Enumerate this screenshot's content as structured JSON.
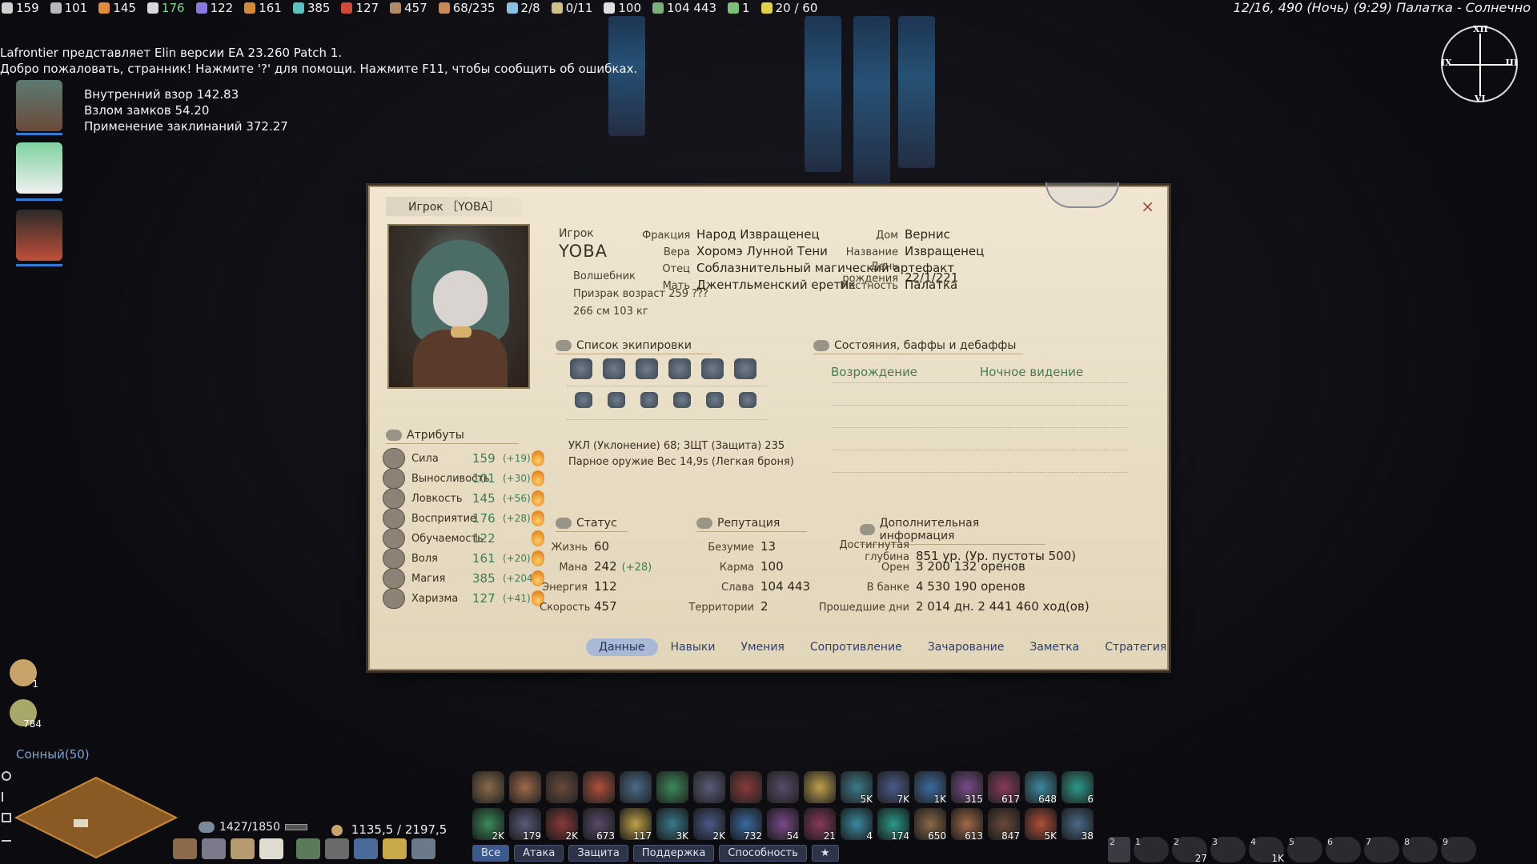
{
  "topbar": {
    "stats": [
      {
        "icon": "sword-icon",
        "value": "159",
        "color": "#cfcfcf"
      },
      {
        "icon": "muscle-icon",
        "value": "101",
        "color": "#b8b8b8"
      },
      {
        "icon": "foot-icon",
        "value": "145",
        "color": "#e38b3c"
      },
      {
        "icon": "eye-icon",
        "value": "176",
        "color": "#d9d9d9",
        "highlight": true
      },
      {
        "icon": "book-icon",
        "value": "122",
        "color": "#8a7ae0"
      },
      {
        "icon": "shield-icon",
        "value": "161",
        "color": "#d08a3a"
      },
      {
        "icon": "magic-icon",
        "value": "385",
        "color": "#5fc0c0"
      },
      {
        "icon": "charm-icon",
        "value": "127",
        "color": "#d04a3a"
      },
      {
        "icon": "bag-icon",
        "value": "457",
        "color": "#b08a6a"
      },
      {
        "icon": "hand-icon",
        "value": "68/235",
        "color": "#c98a5a"
      },
      {
        "icon": "cloud-icon",
        "value": "2/8",
        "color": "#8ac0e0"
      },
      {
        "icon": "boot-icon",
        "value": "0/11",
        "color": "#d0c08a"
      },
      {
        "icon": "star-icon",
        "value": "100",
        "color": "#e0e0e0"
      },
      {
        "icon": "badge-icon",
        "value": "104 443",
        "color": "#7ab07a"
      },
      {
        "icon": "leaf-icon",
        "value": "1",
        "color": "#7ac07a"
      },
      {
        "icon": "lightning-icon",
        "value": "20 / 60",
        "color": "#e0d04a"
      }
    ],
    "right_text": "12/16, 490 (Ночь)  (9:29)  Палатка - Солнечно"
  },
  "compass": {
    "n": "XII",
    "e": "III",
    "s": "VI",
    "w": "IX"
  },
  "log": [
    "Lafrontier представляет Elin версии EA 23.260 Patch 1.",
    "Добро пожаловать, странник! Нажмите '?' для помощи. Нажмите F11, чтобы сообщить об ошибках."
  ],
  "skills_progress": [
    "Внутренний взор  142.83",
    "Взлом замков  54.20",
    "Применение заклинаний  372.27"
  ],
  "panel": {
    "title": "Игрок ［YOBA］",
    "close": "×",
    "player_caption": "Игрок",
    "name": "YOBA",
    "class": "Волшебник",
    "race_age": "Призрак возраст 259 ???",
    "size": "266 см 103 кг",
    "profile": [
      {
        "k": "Фракция",
        "v": "Народ Извращенец"
      },
      {
        "k": "Вера",
        "v": "Хоромэ Лунной Тени"
      },
      {
        "k": "Отец",
        "v": "Соблазнительный магический артефакт"
      },
      {
        "k": "Мать",
        "v": "Джентльменский еретик"
      }
    ],
    "profile2": [
      {
        "k": "Дом",
        "v": "Вернис"
      },
      {
        "k": "Название",
        "v": "Извращенец"
      },
      {
        "k": "День рождения",
        "v": "22/1/221"
      },
      {
        "k": "Местность",
        "v": "Палатка"
      }
    ],
    "equip_title": "Список экипировки",
    "equip_summary_1": "УКЛ (Уклонение) 68; ЗЩТ (Защита) 235",
    "equip_summary_2": "Парное оружие Вес 14,9s (Легкая броня)",
    "buffs_title": "Состояния, баффы и дебаффы",
    "buffs": [
      "Возрождение",
      "Ночное видение"
    ],
    "attr_title": "Атрибуты",
    "attributes": [
      {
        "name": "Сила",
        "value": "159",
        "bonus": "(+19)"
      },
      {
        "name": "Выносливость",
        "value": "101",
        "bonus": "(+30)"
      },
      {
        "name": "Ловкость",
        "value": "145",
        "bonus": "(+56)"
      },
      {
        "name": "Восприятие",
        "value": "176",
        "bonus": "(+28)"
      },
      {
        "name": "Обучаемость",
        "value": "122",
        "bonus": ""
      },
      {
        "name": "Воля",
        "value": "161",
        "bonus": "(+20)"
      },
      {
        "name": "Магия",
        "value": "385",
        "bonus": "(+204)"
      },
      {
        "name": "Харизма",
        "value": "127",
        "bonus": "(+41)"
      }
    ],
    "status_title": "Статус",
    "status": [
      {
        "k": "Жизнь",
        "v": "60",
        "b": ""
      },
      {
        "k": "Мана",
        "v": "242",
        "b": "(+28)"
      },
      {
        "k": "Энергия",
        "v": "112",
        "b": ""
      },
      {
        "k": "Скорость",
        "v": "457",
        "b": ""
      }
    ],
    "rep_title": "Репутация",
    "reputation": [
      {
        "k": "Безумие",
        "v": "13"
      },
      {
        "k": "Карма",
        "v": "100"
      },
      {
        "k": "Слава",
        "v": "104 443"
      },
      {
        "k": "Территории",
        "v": "2"
      }
    ],
    "extra_title": "Дополнительная информация",
    "extra": [
      {
        "k": "Достигнутая глубина",
        "v": "851 ур. (Ур. пустоты 500)"
      },
      {
        "k": "Орен",
        "v": "3 200 132  оренов"
      },
      {
        "k": "В банке",
        "v": "4 530 190  оренов"
      },
      {
        "k": "Прошедшие дни",
        "v": "2 014 дн. 2 441 460 ход(ов)"
      }
    ],
    "tabs": [
      "Данные",
      "Навыки",
      "Умения",
      "Сопротивление",
      "Зачарование",
      "Заметка",
      "Стратегия"
    ],
    "active_tab": "Данные"
  },
  "hud": {
    "zone": "Сонный(50)",
    "weight": "1427/1850",
    "money": "1135,5 / 2197,5",
    "side_counts": [
      "1",
      "784"
    ],
    "hotbar_row1": [
      "",
      "",
      "",
      "",
      "",
      "",
      "",
      "",
      "",
      "",
      "5K",
      "7K",
      "1K",
      "315",
      "617",
      "648",
      "6"
    ],
    "hotbar_row2": [
      "2K",
      "179",
      "2K",
      "673",
      "117",
      "3K",
      "2K",
      "732",
      "54",
      "21",
      "4",
      "174",
      "650",
      "613",
      "847",
      "5K",
      "38"
    ],
    "filters": [
      "Все",
      "Атака",
      "Защита",
      "Поддержка",
      "Способность",
      "★"
    ],
    "quick_numbers": [
      "2",
      "1",
      "2",
      "3",
      "4",
      "5",
      "6",
      "7",
      "8",
      "9"
    ],
    "quick_counts": [
      "",
      "",
      "27",
      "",
      "1K",
      "",
      "",
      "",
      "",
      ""
    ]
  }
}
